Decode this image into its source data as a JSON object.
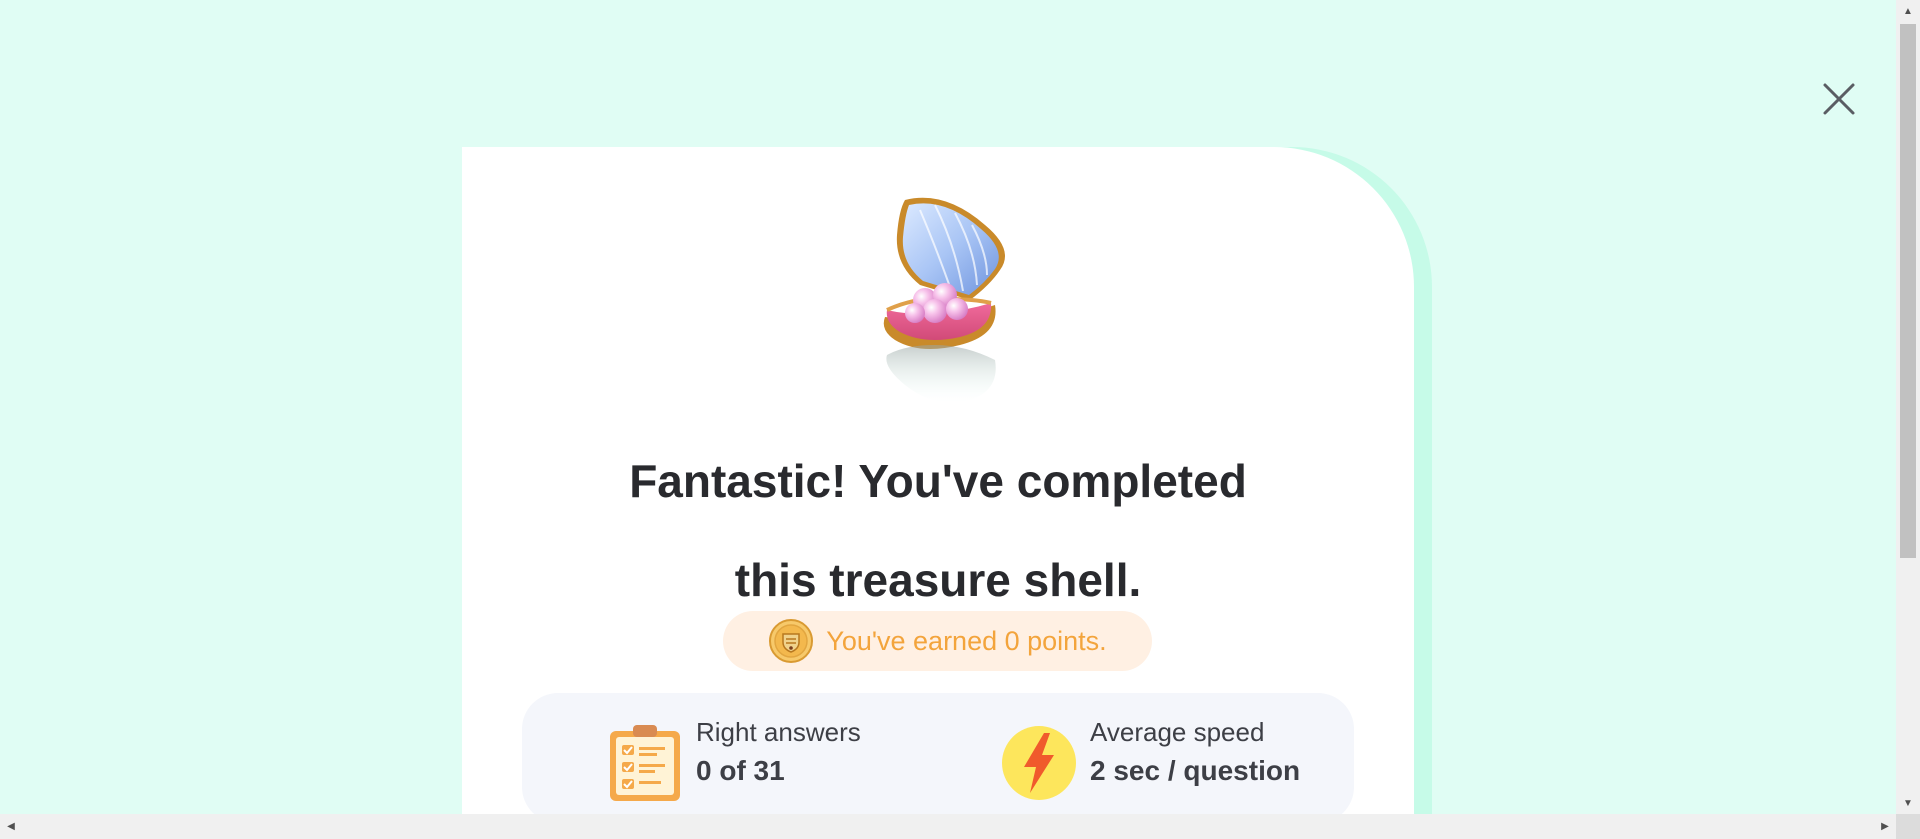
{
  "modal": {
    "close_icon": "close-icon",
    "illustration": "treasure-shell-illustration",
    "headline_line1": "Fantastic! You've completed",
    "headline_line2": "this treasure shell.",
    "points_text": "You've earned 0 points.",
    "points_icon": "coin-icon"
  },
  "stats": {
    "right_answers": {
      "label": "Right answers",
      "value": "0 of 31",
      "icon": "clipboard-checklist-icon"
    },
    "average_speed": {
      "label": "Average speed",
      "value": "2 sec / question",
      "icon": "lightning-bolt-icon"
    }
  },
  "colors": {
    "background": "#e0fdf4",
    "card": "#ffffff",
    "card_accent": "#c6fbe8",
    "headline": "#292a2e",
    "points_text": "#f3a43c",
    "points_pill": "#fff0e3",
    "stats_panel": "#f4f6fb"
  }
}
